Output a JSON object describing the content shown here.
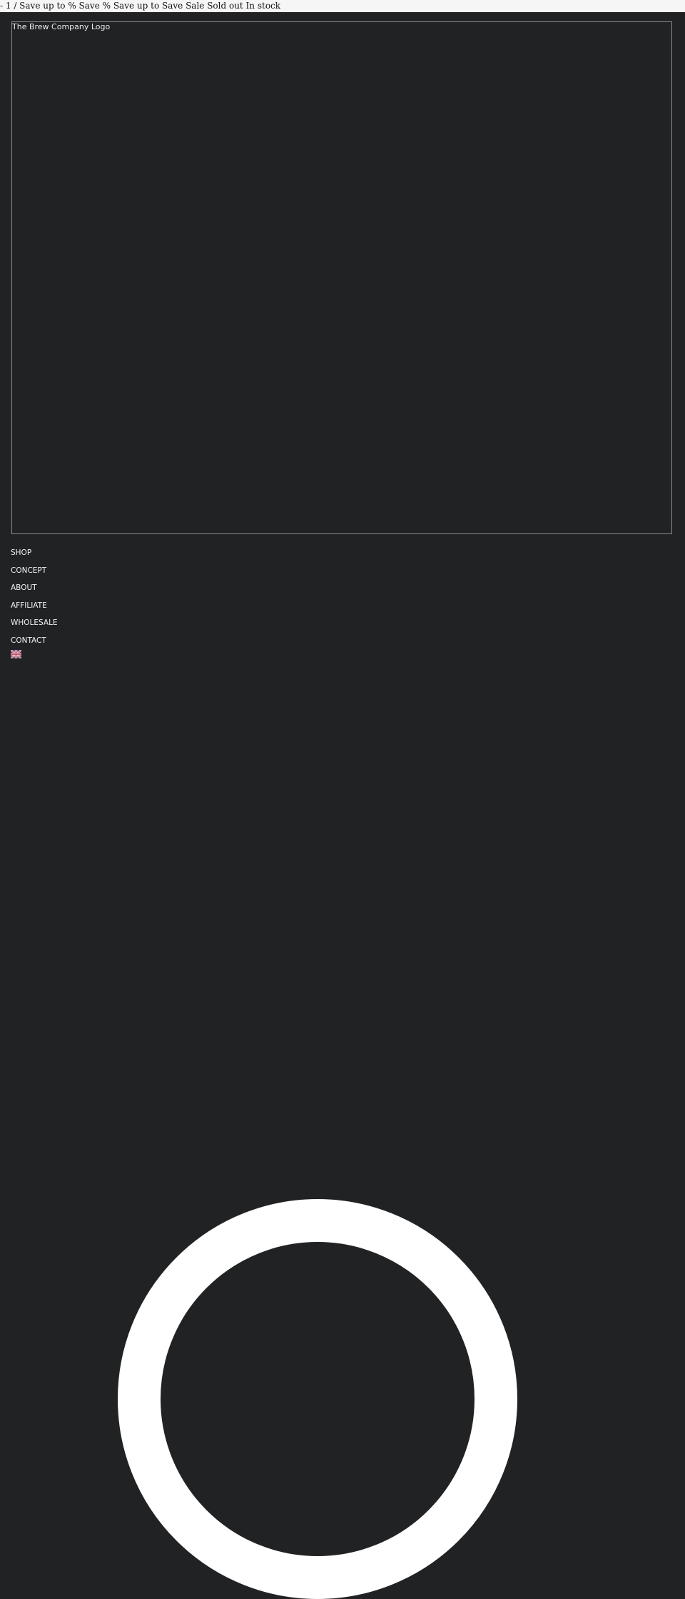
{
  "announcement": {
    "text": "- 1 / Save up to % Save % Save up to Save Sale Sold out In stock"
  },
  "header": {
    "logo_alt": "The Brew Company Logo"
  },
  "nav": {
    "items": [
      {
        "label": "SHOP"
      },
      {
        "label": "CONCEPT"
      },
      {
        "label": "ABOUT"
      },
      {
        "label": "AFFILIATE"
      },
      {
        "label": "WHOLESALE"
      },
      {
        "label": "CONTACT"
      }
    ]
  },
  "language": {
    "flag_icon": "uk-flag-icon"
  },
  "colors": {
    "background": "#212224",
    "topbar": "#f6f6f6",
    "text": "#f2f2f2",
    "spinner": "#ffffff"
  },
  "loader": {
    "icon": "loading-spinner-icon"
  }
}
